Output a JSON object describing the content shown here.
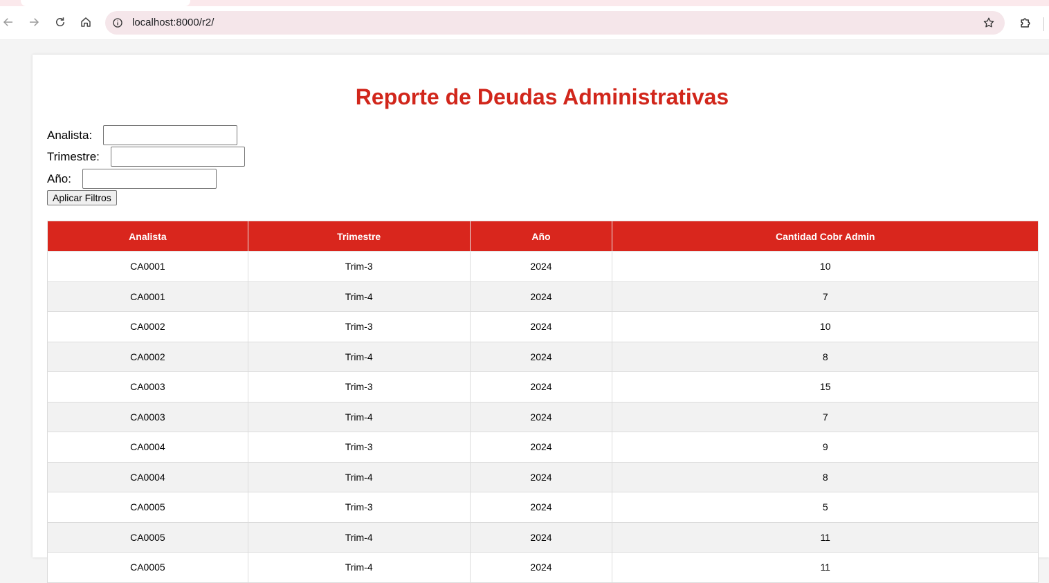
{
  "browser": {
    "url": "localhost:8000/r2/",
    "icons": {
      "back": "arrow-left-icon",
      "forward": "arrow-right-icon",
      "reload": "reload-icon",
      "home": "home-icon",
      "info": "info-icon",
      "bookmark": "star-icon",
      "extensions": "puzzle-icon"
    }
  },
  "page": {
    "title": "Reporte de Deudas Administrativas",
    "title_color": "#d1261b",
    "header_color": "#d9261d"
  },
  "filters": {
    "analista_label": "Analista:",
    "analista_value": "",
    "trimestre_label": "Trimestre:",
    "trimestre_value": "",
    "anio_label": "Año:",
    "anio_value": "",
    "apply_label": "Aplicar Filtros"
  },
  "table": {
    "headers": [
      "Analista",
      "Trimestre",
      "Año",
      "Cantidad Cobr Admin"
    ],
    "rows": [
      [
        "CA0001",
        "Trim-3",
        "2024",
        "10"
      ],
      [
        "CA0001",
        "Trim-4",
        "2024",
        "7"
      ],
      [
        "CA0002",
        "Trim-3",
        "2024",
        "10"
      ],
      [
        "CA0002",
        "Trim-4",
        "2024",
        "8"
      ],
      [
        "CA0003",
        "Trim-3",
        "2024",
        "15"
      ],
      [
        "CA0003",
        "Trim-4",
        "2024",
        "7"
      ],
      [
        "CA0004",
        "Trim-3",
        "2024",
        "9"
      ],
      [
        "CA0004",
        "Trim-4",
        "2024",
        "8"
      ],
      [
        "CA0005",
        "Trim-3",
        "2024",
        "5"
      ],
      [
        "CA0005",
        "Trim-4",
        "2024",
        "11"
      ],
      [
        "CA0005",
        "Trim-4",
        "2024",
        "11"
      ]
    ]
  }
}
